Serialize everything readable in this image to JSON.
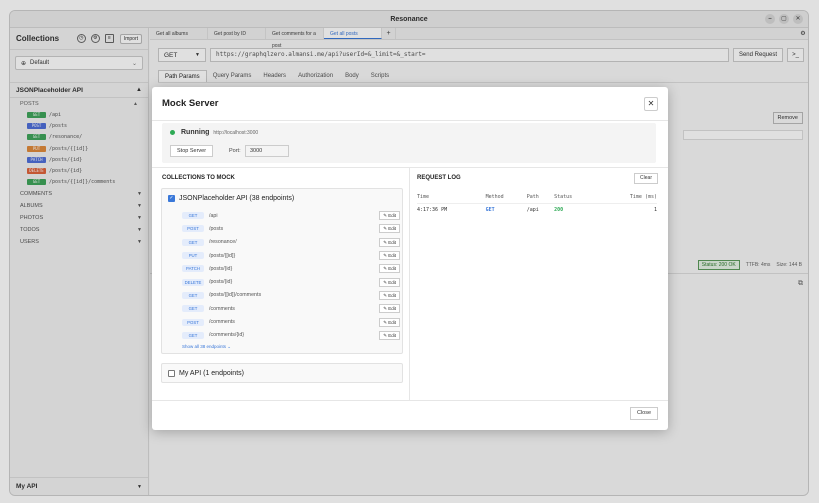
{
  "window": {
    "title": "Resonance",
    "min_glyph": "–",
    "max_glyph": "▢",
    "close_glyph": "✕"
  },
  "sidebar": {
    "title": "Collections",
    "import_label": "Import",
    "environment": "Default",
    "collection": "JSONPlaceholder API",
    "posts_group": "POSTS",
    "endpoints": [
      {
        "method": "GET",
        "path": "/api",
        "color": "#3fa45a"
      },
      {
        "method": "POST",
        "path": "/posts",
        "color": "#4f6fd9"
      },
      {
        "method": "GET",
        "path": "/resonance/",
        "color": "#3fa45a"
      },
      {
        "method": "PUT",
        "path": "/posts/{[id]}",
        "color": "#e08a3c"
      },
      {
        "method": "PATCH",
        "path": "/posts/{id}",
        "color": "#4f6fd9"
      },
      {
        "method": "DELETE",
        "path": "/posts/{id}",
        "color": "#e0643c"
      },
      {
        "method": "GET",
        "path": "/posts/{[id]}/comments",
        "color": "#3fa45a"
      }
    ],
    "categories": [
      "COMMENTS",
      "ALBUMS",
      "PHOTOS",
      "TODOS",
      "USERS"
    ],
    "my_api": "My API"
  },
  "tabs": [
    "Get all albums",
    "Get post by ID",
    "Get comments for a post",
    "Get all posts"
  ],
  "active_tab": 3,
  "request": {
    "method": "GET",
    "url": "https://graphqlzero.almansi.me/api?userId=&_limit=&_start=",
    "send_label": "Send Request",
    "code_label": ">_"
  },
  "subtabs": [
    "Path Params",
    "Query Params",
    "Headers",
    "Authorization",
    "Body",
    "Scripts"
  ],
  "remove_label": "Remove",
  "response": {
    "status": "Status: 200 OK",
    "ttfb": "TTFB: 4ms",
    "size": "Size: 144 B"
  },
  "modal": {
    "title": "Mock Server",
    "status": "Running",
    "address": "http://localhost:3000",
    "stop_label": "Stop Server",
    "port_label": "Port:",
    "port_value": "3000",
    "collections_title": "COLLECTIONS TO MOCK",
    "collections": [
      {
        "name": "JSONPlaceholder API (38 endpoints)",
        "checked": true,
        "endpoints": [
          {
            "method": "GET",
            "path": "/api"
          },
          {
            "method": "POST",
            "path": "/posts"
          },
          {
            "method": "GET",
            "path": "/resonance/"
          },
          {
            "method": "PUT",
            "path": "/posts/{[id]}"
          },
          {
            "method": "PATCH",
            "path": "/posts/{id}"
          },
          {
            "method": "DELETE",
            "path": "/posts/{id}"
          },
          {
            "method": "GET",
            "path": "/posts/{[id]}/comments"
          },
          {
            "method": "GET",
            "path": "/comments"
          },
          {
            "method": "POST",
            "path": "/comments"
          },
          {
            "method": "GET",
            "path": "/comments/{id}"
          }
        ],
        "edit_label": "Edit",
        "show_all": "Show all 38 endpoints ⌄"
      },
      {
        "name": "My API (1 endpoints)",
        "checked": false
      }
    ],
    "log_title": "REQUEST LOG",
    "clear_label": "Clear",
    "log_headers": [
      "Time",
      "Method",
      "Path",
      "Status",
      "Time (ms)"
    ],
    "log_rows": [
      [
        "4:17:36 PM",
        "GET",
        "/api",
        "200",
        "1"
      ]
    ],
    "close_label": "Close",
    "close_glyph": "✕"
  }
}
